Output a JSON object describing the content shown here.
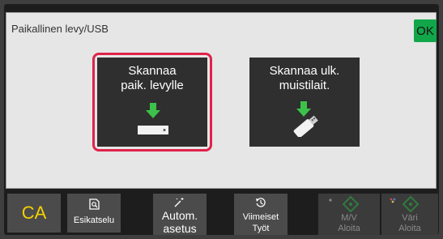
{
  "panel": {
    "title": "Paikallinen levy/USB",
    "ok_label": "OK"
  },
  "tiles": [
    {
      "line1": "Skannaa",
      "line2": "paik. levylle",
      "icon": "save-to-drive-icon",
      "selected": true
    },
    {
      "line1": "Skannaa ulk.",
      "line2": "muistilait.",
      "icon": "save-to-usb-icon",
      "selected": false
    }
  ],
  "bottom_bar": {
    "ca_label": "CA",
    "preview_label": "Esikatselu",
    "auto_line1": "Autom.",
    "auto_line2": "asetus",
    "recent_line1": "Viimeiset",
    "recent_line2": "Työt",
    "mono_line1": "M/V",
    "mono_line2": "Aloita",
    "color_line1": "Väri",
    "color_line2": "Aloita"
  },
  "colors": {
    "accent_selection": "#e0234a",
    "ok_green": "#12a64a",
    "icon_green": "#3cc24a",
    "ca_yellow": "#f4d000"
  }
}
